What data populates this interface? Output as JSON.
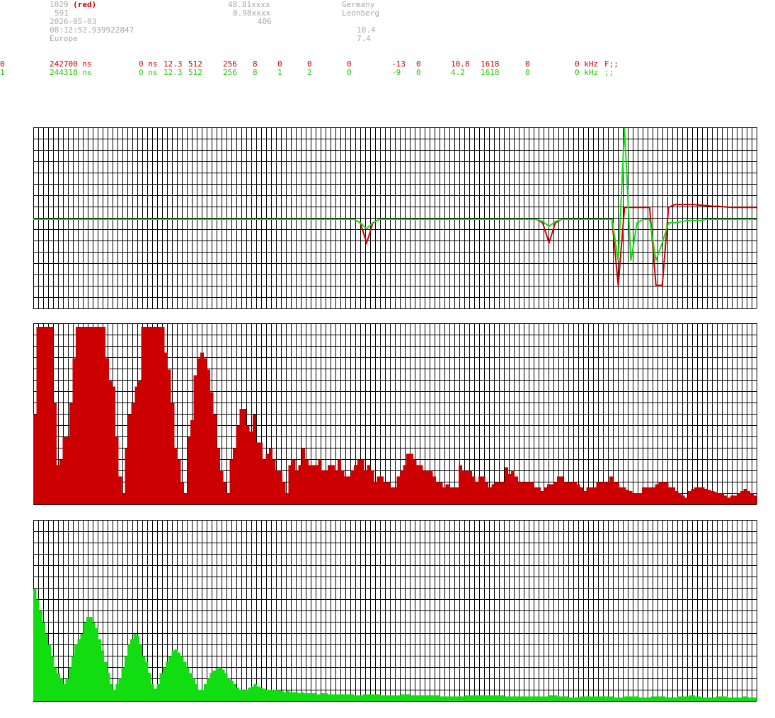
{
  "header": {
    "station_id": "1029",
    "station_color_tag": "(red)",
    "line2": "591",
    "date": "2026-05-03",
    "time": "08:12:52.939922847",
    "region": "Europe",
    "lat": "48.81xxxx",
    "lon": "8.98xxxx",
    "altitude": "406",
    "country": "Germany",
    "city": "Leonberg",
    "value_a": "10.4",
    "value_b": "7.4"
  },
  "channels": [
    {
      "idx": "0",
      "t": "242700 ns",
      "c2": "0 ns",
      "c3": "12.3",
      "c4": "512",
      "c5": "256",
      "c6": "8",
      "c7": "0",
      "c8": "0",
      "c9": "0",
      "c10": "-13",
      "c11": "0",
      "c12": "10.8",
      "c13": "1618",
      "c14": "0",
      "c15": "0 kHz",
      "c16": "F;;",
      "color": "#cc0000"
    },
    {
      "idx": "1",
      "t": "244318 ns",
      "c2": "0 ns",
      "c3": "12.3",
      "c4": "512",
      "c5": "256",
      "c6": "8",
      "c7": "1",
      "c8": "2",
      "c9": "0",
      "c10": "-9",
      "c11": "0",
      "c12": "4.2",
      "c13": "1618",
      "c14": "0",
      "c15": "0 kHz",
      "c16": ";;",
      "color": "#22cc00"
    }
  ],
  "colors": {
    "red": "#cc0000",
    "green": "#11dd11",
    "grid": "#000000"
  },
  "chart_data": [
    {
      "type": "line",
      "series": [
        {
          "color": "#cc0000",
          "values": [
            0,
            0,
            0,
            0,
            0,
            0,
            0,
            0,
            0,
            0,
            0,
            0,
            0,
            0,
            0,
            0,
            0,
            0,
            0,
            0,
            0,
            0,
            0,
            0,
            0,
            0,
            0,
            0,
            0,
            0,
            0,
            0,
            0,
            0,
            0,
            0,
            0,
            0,
            0,
            0,
            0,
            0,
            0,
            0,
            0,
            0,
            0,
            0,
            0,
            0,
            0,
            0,
            -0.3,
            -2,
            -0.3,
            0,
            0,
            0,
            0,
            0,
            0,
            0,
            0,
            0,
            0,
            0,
            0,
            0,
            0,
            0,
            0,
            0,
            0,
            0,
            0,
            0,
            0,
            0,
            0,
            0,
            0,
            -0.3,
            -2,
            -0.3,
            0,
            0,
            0,
            0,
            0,
            0,
            0,
            0,
            0,
            -5.6,
            1.0,
            1.0,
            1.0,
            1.0,
            1.0,
            -5.6,
            -5.6,
            1.0,
            1.25,
            1.25,
            1.25,
            1.25,
            1.2,
            1.15,
            1.1,
            1.1,
            1.05,
            1.0,
            1.0,
            1.0,
            1.0,
            1.0
          ]
        },
        {
          "color": "#11dd11",
          "values": [
            0,
            0,
            0,
            0,
            0,
            0,
            0,
            0,
            0,
            0,
            0,
            0,
            0,
            0,
            0,
            0,
            0,
            0,
            0,
            0,
            0,
            0,
            0,
            0,
            0,
            0,
            0,
            0,
            0,
            0,
            0,
            0,
            0,
            0,
            0,
            0,
            0,
            0,
            0,
            0,
            0,
            0,
            0,
            0,
            0,
            0,
            0,
            0,
            0,
            0,
            0,
            0,
            -0.3,
            -0.8,
            -0.3,
            0,
            0,
            0,
            0,
            0,
            0,
            0,
            0,
            0,
            0,
            0,
            0,
            0,
            0,
            0,
            0,
            0,
            0,
            0,
            0,
            0,
            0,
            0,
            0,
            0,
            0,
            -0.2,
            -0.6,
            -0.2,
            0,
            0,
            0,
            0,
            0,
            0,
            0,
            0,
            0,
            -3.5,
            9.5,
            -3.5,
            -0.3,
            0,
            0,
            -3.5,
            -2,
            -0.3,
            -0.3,
            -0.2,
            -0.1,
            -0.1,
            -0.1,
            0,
            0,
            0,
            0,
            0,
            0,
            0,
            0,
            0
          ]
        }
      ]
    },
    {
      "type": "bar",
      "ylim": [
        0,
        16
      ],
      "values": [
        8,
        15.8,
        15.8,
        15.8,
        15.8,
        15.8,
        9,
        3.5,
        4,
        6,
        6,
        9,
        13,
        15.8,
        15.8,
        15.8,
        15.8,
        15.8,
        15.8,
        15.8,
        15.8,
        15.8,
        13,
        11,
        10.5,
        6,
        2.5,
        1,
        5,
        8,
        9,
        10.5,
        11,
        15.8,
        15.8,
        15.8,
        15.8,
        15.8,
        15.8,
        15.8,
        13.5,
        12,
        9,
        5,
        4,
        2,
        1,
        6,
        7.5,
        11.5,
        13,
        13.5,
        13,
        12,
        10,
        8,
        5,
        3,
        2,
        1,
        4,
        5,
        7,
        8.5,
        8.5,
        7,
        6.5,
        8,
        5.5,
        5.5,
        4,
        4.5,
        5,
        4,
        3,
        3,
        2,
        1,
        3.5,
        4,
        3,
        3.5,
        5,
        4,
        3.5,
        3.5,
        3.5,
        4,
        3,
        3,
        3.5,
        3.5,
        3,
        4,
        3,
        2.5,
        2.5,
        3,
        3.5,
        4,
        4,
        3,
        3.5,
        3,
        2,
        2.5,
        2.5,
        2,
        2,
        1.5,
        1.5,
        2.5,
        3,
        3.5,
        4.5,
        4.5,
        4,
        3.5,
        3.5,
        3,
        3,
        3,
        2.5,
        2,
        2,
        1.5,
        1.8,
        1.5,
        1.5,
        1.5,
        3.5,
        3,
        3,
        3,
        2.5,
        2,
        2.5,
        2.5,
        2,
        1.5,
        1.8,
        2,
        2,
        2,
        3.3,
        2.7,
        3,
        2.5,
        2,
        2,
        2,
        2,
        2,
        1.5,
        1.5,
        1.2,
        1.5,
        1.8,
        1.8,
        2,
        2.5,
        2.5,
        2,
        2,
        2,
        2,
        1.8,
        1.5,
        1.2,
        1.5,
        1.5,
        1.5,
        2,
        2,
        2,
        2,
        2.5,
        2,
        2,
        1.5,
        1.5,
        1.3,
        1.2,
        1,
        1,
        1,
        1.5,
        1.5,
        1.5,
        1.5,
        1.8,
        2,
        2,
        2,
        1.5,
        1.5,
        1.2,
        1,
        0.8,
        0.6,
        1.2,
        1.4,
        1.5,
        1.5,
        1.5,
        1.4,
        1.3,
        1.2,
        1.1,
        1,
        1,
        0.8,
        0.6,
        0.8,
        0.8,
        1,
        1.2,
        1.4,
        1.2,
        1,
        0.8
      ]
    },
    {
      "type": "bar",
      "ylim": [
        0,
        16
      ],
      "values": [
        10,
        9,
        8,
        7,
        6,
        5,
        4,
        3,
        2.5,
        2,
        1.5,
        2,
        3,
        4,
        5,
        5.5,
        6,
        7,
        7.5,
        7.5,
        7,
        6.5,
        5.5,
        4.5,
        3.5,
        2.5,
        1.5,
        1,
        1.5,
        2,
        3,
        4,
        5,
        5.5,
        6,
        5.8,
        5,
        4,
        3.5,
        2.5,
        1.5,
        1.1,
        1.5,
        2.5,
        3,
        3.5,
        4,
        4.5,
        4.6,
        4.3,
        4,
        3.5,
        3,
        2.5,
        2,
        1.5,
        1,
        1,
        1.5,
        2,
        2.5,
        2.7,
        2.9,
        3,
        2.8,
        2.5,
        2,
        1.8,
        1.5,
        1.2,
        1,
        0.9,
        1,
        1.2,
        1.3,
        1.5,
        1.3,
        1.2,
        1.1,
        1,
        1,
        1,
        1,
        0.9,
        0.9,
        0.8,
        0.9,
        0.8,
        0.8,
        0.8,
        0.7,
        0.8,
        0.7,
        0.7,
        0.7,
        0.7,
        0.6,
        0.6,
        0.7,
        0.7,
        0.6,
        0.6,
        0.6,
        0.6,
        0.6,
        0.6,
        0.6,
        0.6,
        0.6,
        0.5,
        0.5,
        0.5,
        0.6,
        0.6,
        0.6,
        0.6,
        0.6,
        0.6,
        0.5,
        0.5,
        0.5,
        0.5,
        0.5,
        0.5,
        0.5,
        0.6,
        0.6,
        0.6,
        0.5,
        0.5,
        0.5,
        0.5,
        0.5,
        0.5,
        0.5,
        0.5,
        0.5,
        0.5,
        0.4,
        0.4,
        0.4,
        0.4,
        0.4,
        0.4,
        0.4,
        0.4,
        0.4,
        0.5,
        0.5,
        0.5,
        0.5,
        0.5,
        0.5,
        0.5,
        0.5,
        0.5,
        0.5,
        0.5,
        0.5,
        0.5,
        0.4,
        0.4,
        0.4,
        0.4,
        0.4,
        0.4,
        0.4,
        0.4,
        0.4,
        0.4,
        0.4,
        0.4,
        0.4,
        0.4,
        0.4,
        0.5,
        0.5,
        0.5,
        0.4,
        0.4,
        0.4,
        0.4,
        0.3,
        0.3,
        0.3,
        0.3,
        0.4,
        0.4,
        0.4,
        0.4,
        0.4,
        0.4,
        0.4,
        0.4,
        0.4,
        0.4,
        0.4,
        0.3,
        0.3,
        0.3,
        0.3,
        0.4,
        0.4,
        0.4,
        0.4,
        0.4,
        0.3,
        0.3,
        0.3,
        0.3,
        0.4,
        0.4,
        0.4,
        0.4,
        0.4,
        0.3,
        0.3,
        0.3,
        0.3,
        0.4,
        0.4,
        0.4,
        0.4,
        0.5,
        0.5,
        0.4,
        0.4,
        0.3,
        0.3,
        0.3,
        0.3,
        0.3,
        0.4,
        0.4,
        0.4,
        0.4,
        0.3,
        0.3,
        0.3,
        0.3,
        0.3,
        0.4,
        0.4,
        0.3,
        0.3,
        0.3
      ]
    }
  ]
}
